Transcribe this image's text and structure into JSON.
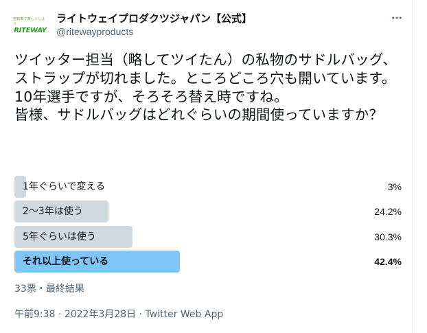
{
  "account": {
    "display_name": "ライトウェイプロダクツジャパン【公式】",
    "handle": "@ritewayproducts",
    "avatar": {
      "tagline": "自転車で楽しくしよう",
      "wordmark": "RITEWAY",
      "color": "#2f9a2f"
    }
  },
  "more_icon": "more-horizontal-icon",
  "tweet": {
    "text": "ツイッター担当（略してツイたん）の私物のサドルバッグ、ストラップが切れました。ところどころ穴も開いています。10年選手ですが、そろそろ替え時ですね。\n皆様、サドルバッグはどれぐらいの期間使っていますか？"
  },
  "poll": {
    "options": [
      {
        "label": "1年ぐらいで変える",
        "percent_text": "3%",
        "percent": 3.0,
        "winner": false
      },
      {
        "label": "2〜3年は使う",
        "percent_text": "24.2%",
        "percent": 24.2,
        "winner": false
      },
      {
        "label": "5年ぐらいは使う",
        "percent_text": "30.3%",
        "percent": 30.3,
        "winner": false
      },
      {
        "label": "それ以上使っている",
        "percent_text": "42.4%",
        "percent": 42.4,
        "winner": true
      }
    ],
    "summary": "33票・最終結果",
    "colors": {
      "bar": "#cfd9de",
      "winner_bar": "#80c5f8"
    }
  },
  "meta": {
    "time": "午前9:38",
    "date": "2022年3月28日",
    "separator": " · ",
    "source": "Twitter Web App"
  }
}
